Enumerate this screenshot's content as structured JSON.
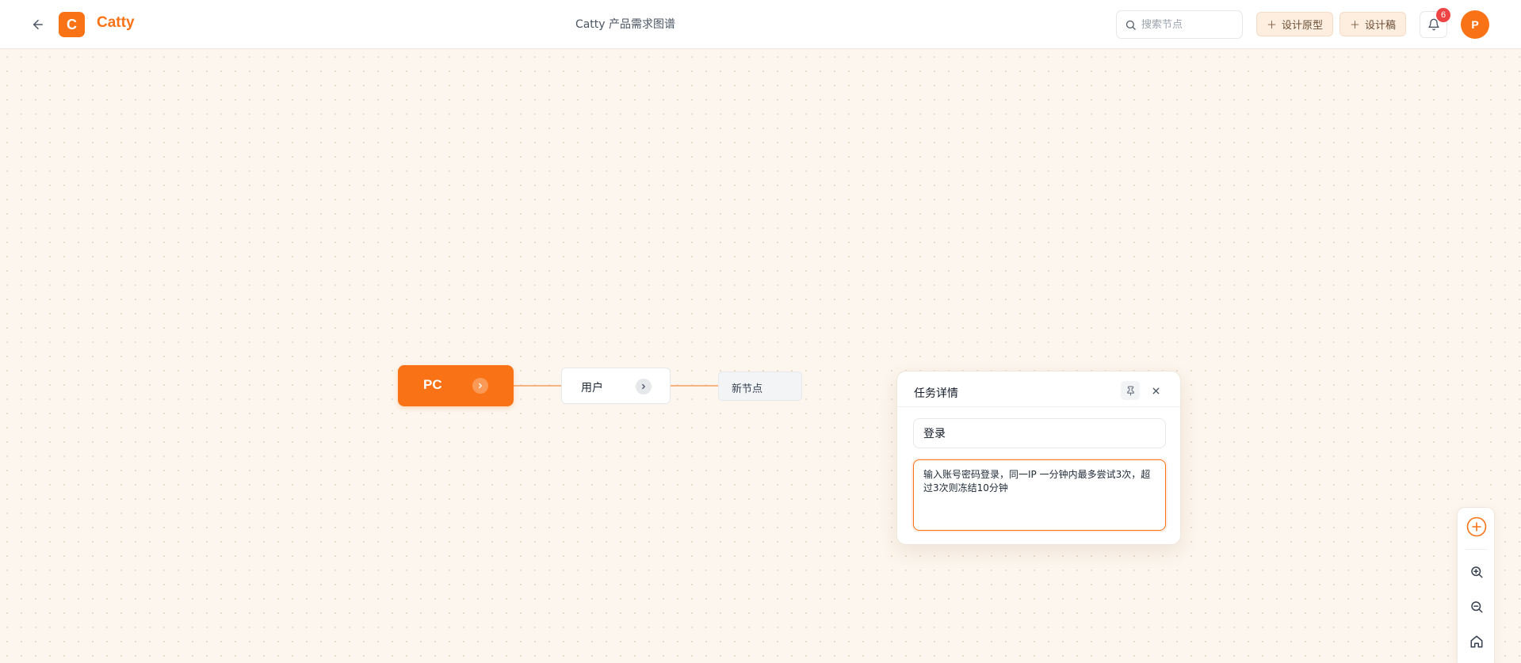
{
  "header": {
    "logo_letter": "C",
    "app_name": "Catty",
    "doc_title": "Catty 产品需求图谱",
    "search": {
      "placeholder": "搜索节点"
    },
    "buttons": [
      {
        "label": "设计原型"
      },
      {
        "label": "设计稿"
      }
    ],
    "notifications": {
      "count": "6"
    },
    "avatar_letter": "P"
  },
  "nodes": {
    "root": {
      "label": "PC"
    },
    "child": {
      "label": "用户"
    },
    "new_node": {
      "label": "新节点"
    }
  },
  "task_panel": {
    "title": "任务详情",
    "task_name": "登录",
    "description": "输入账号密码登录，同一IP 一分钟内最多尝试3次，超过3次则冻结10分钟"
  },
  "colors": {
    "brand": "#f97316",
    "canvas_bg": "#fdf6ee",
    "badge": "#ef4444"
  },
  "icons": {
    "back": "arrow-left-icon",
    "search": "search-icon",
    "plus": "plus-icon",
    "bell": "bell-icon",
    "pin": "pin-icon",
    "close": "close-icon",
    "expand": "chevron-right-icon",
    "add": "plus-circle-icon",
    "zoom_in": "zoom-in-icon",
    "zoom_out": "zoom-out-icon",
    "home": "home-icon"
  }
}
